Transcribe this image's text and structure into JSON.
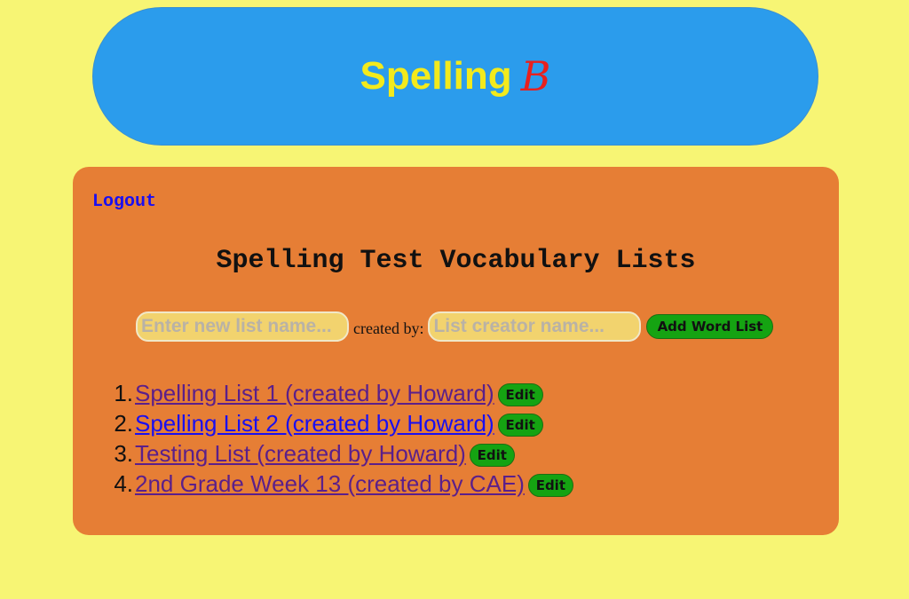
{
  "header": {
    "title": "Spelling",
    "title_mark": "B"
  },
  "panel": {
    "logout_label": "Logout",
    "title": "Spelling Test Vocabulary Lists"
  },
  "form": {
    "list_name_placeholder": "Enter new list name...",
    "created_by_label": "created by:",
    "creator_placeholder": "List creator name...",
    "add_button_label": "Add Word List"
  },
  "word_lists": [
    {
      "num": "1.",
      "label": "Spelling List 1 (created by Howard)",
      "edit_label": "Edit"
    },
    {
      "num": "2.",
      "label": "Spelling List 2 (created by Howard)",
      "edit_label": "Edit"
    },
    {
      "num": "3.",
      "label": "Testing List (created by Howard)",
      "edit_label": "Edit"
    },
    {
      "num": "4.",
      "label": "2nd Grade Week 13 (created by CAE)",
      "edit_label": "Edit"
    }
  ],
  "colors": {
    "page_background": "#f7f574",
    "header_background": "#2b9cec",
    "header_text": "#f3ea1c",
    "header_mark": "#e8201e",
    "panel_background": "#e67e35",
    "button_green": "#15a312",
    "link_visited": "#5b1f8a",
    "link_unvisited": "#1a0ff0"
  }
}
